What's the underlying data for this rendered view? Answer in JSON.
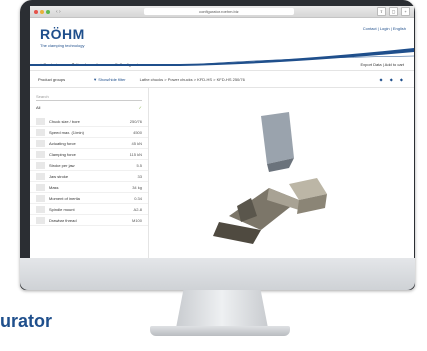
{
  "browser": {
    "url": "configurator.roehm.biz"
  },
  "header": {
    "logo": "RÖHM",
    "tagline": "The clamping technology",
    "toplinks": "Contact | Login | English"
  },
  "menu": {
    "items": [
      "Products",
      "Your favourites",
      "Configurator"
    ],
    "right": "Export Data   |   Add to cart"
  },
  "subbar": {
    "left": "Product groups",
    "filter": "▼ Show/hide filter",
    "crumbs": "Lathe chucks > Power chucks > KFD-HS > KFD-HS 250/76",
    "icons": "◆ ◆ ◆"
  },
  "sidebar": {
    "search_placeholder": "Search",
    "all_label": "All",
    "all_count": "✓",
    "rows": [
      {
        "label": "Chuck size / bore",
        "val": "250/76"
      },
      {
        "label": "Speed max. (1/min)",
        "val": "4500"
      },
      {
        "label": "Actuating force",
        "val": "45 kN"
      },
      {
        "label": "Clamping force",
        "val": "115 kN"
      },
      {
        "label": "Stroke per jaw",
        "val": "5.5"
      },
      {
        "label": "Jaw stroke",
        "val": "33"
      },
      {
        "label": "Mass",
        "val": "34 kg"
      },
      {
        "label": "Moment of inertia",
        "val": "0.34"
      },
      {
        "label": "Spindle mount",
        "val": "A2-8"
      },
      {
        "label": "Drawbar thread",
        "val": "M100"
      }
    ]
  },
  "caption": "urator",
  "colors": {
    "brand": "#1f4f8c",
    "bezel": "#2b2e33"
  }
}
